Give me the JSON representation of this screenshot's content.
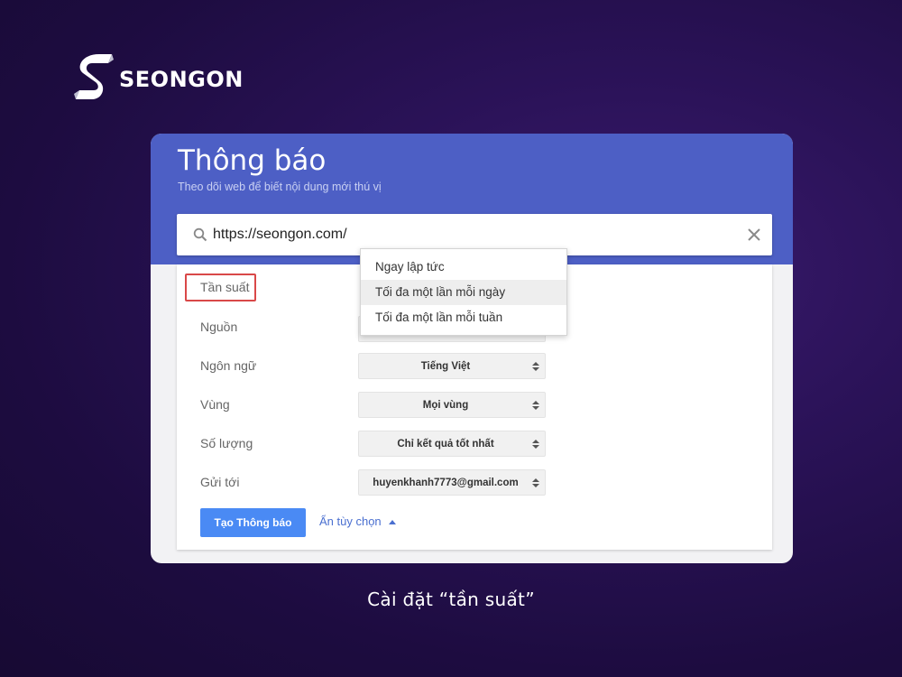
{
  "brand": {
    "name": "SEONGON"
  },
  "alert": {
    "title": "Thông báo",
    "subtitle": "Theo dõi web để biết nội dung mới thú vị",
    "search": {
      "value": "https://seongon.com/"
    },
    "options": {
      "frequency_label": "Tần suất",
      "source_label": "Nguồn",
      "language": {
        "label": "Ngôn ngữ",
        "value": "Tiếng Việt"
      },
      "region": {
        "label": "Vùng",
        "value": "Mọi vùng"
      },
      "quantity": {
        "label": "Số lượng",
        "value": "Chỉ kết quả tốt nhất"
      },
      "send_to": {
        "label": "Gửi tới",
        "value": "huyenkhanh7773@gmail.com"
      }
    },
    "create_button": "Tạo Thông báo",
    "hide_options": "Ẩn tùy chọn",
    "frequency_dropdown": {
      "items": [
        "Ngay lập tức",
        "Tối đa một lần mỗi ngày",
        "Tối đa một lần mỗi tuần"
      ],
      "highlighted": "Tối đa một lần mỗi ngày"
    }
  },
  "caption": "Cài đặt “tần suất”",
  "colors": {
    "header": "#4d5fc5",
    "button": "#4a8af4",
    "highlight_border": "#d94848",
    "background": "#2a1257"
  }
}
